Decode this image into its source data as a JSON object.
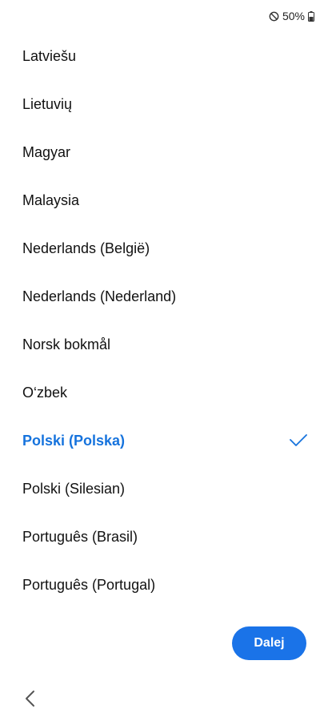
{
  "status_bar": {
    "battery_text": "50%",
    "dnd_icon": "do-not-disturb-icon",
    "battery_icon": "battery-icon"
  },
  "languages": [
    {
      "label": "Latviešu"
    },
    {
      "label": "Lietuvių"
    },
    {
      "label": "Magyar"
    },
    {
      "label": "Malaysia"
    },
    {
      "label": "Nederlands (België)"
    },
    {
      "label": "Nederlands (Nederland)"
    },
    {
      "label": "Norsk bokmål"
    },
    {
      "label": "O‘zbek"
    },
    {
      "label": "Polski (Polska)",
      "selected": true
    },
    {
      "label": "Polski (Silesian)"
    },
    {
      "label": "Português (Brasil)"
    },
    {
      "label": "Português (Portugal)"
    }
  ],
  "actions": {
    "next_label": "Dalej"
  },
  "colors": {
    "accent": "#1673dd",
    "button_bg": "#1a73e8"
  },
  "icons": {
    "check": "check-icon",
    "back": "chevron-left-icon"
  }
}
